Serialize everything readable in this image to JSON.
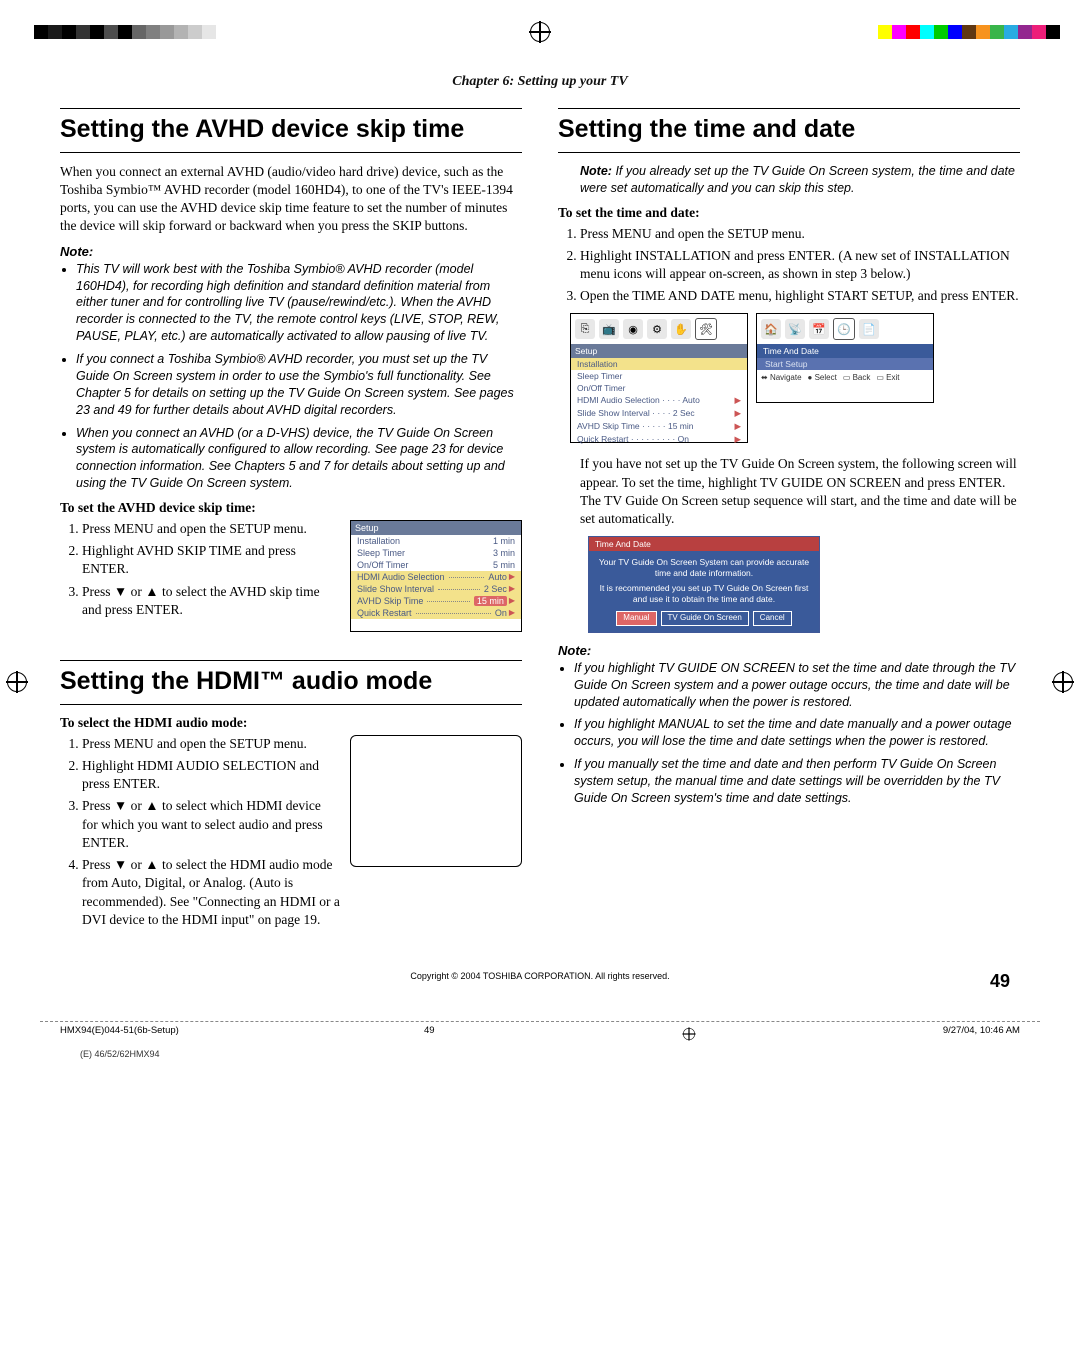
{
  "chapter": "Chapter 6: Setting up your TV",
  "left": {
    "h1": "Setting the AVHD device skip time",
    "intro": "When you connect an external AVHD (audio/video hard drive) device, such as the Toshiba Symbio™ AVHD recorder (model 160HD4), to one of the TV's IEEE-1394 ports, you can use the AVHD device skip time feature to set the number of minutes the device will skip forward or backward when you press the SKIP buttons.",
    "note_head": "Note:",
    "notes": [
      "This TV will work best with the Toshiba Symbio® AVHD recorder (model 160HD4), for recording high definition and standard definition material from either tuner and for controlling live TV (pause/rewind/etc.). When the AVHD recorder is connected to the TV, the remote control keys (LIVE, STOP, REW, PAUSE, PLAY, etc.) are automatically activated to allow pausing of live TV.",
      "If you connect a Toshiba Symbio® AVHD recorder, you must set up the TV Guide On Screen system in order to use the Symbio's full functionality. See Chapter 5 for details on setting up the TV Guide On Screen system. See pages 23 and 49 for further details about AVHD digital recorders.",
      "When you connect an AVHD (or a D-VHS) device, the TV Guide On Screen system is automatically configured to allow recording. See page 23 for device connection information. See Chapters 5 and 7 for details about setting up and using the TV Guide On Screen system."
    ],
    "sub": "To set the AVHD device skip time:",
    "steps": [
      "Press MENU and open the SETUP menu.",
      "Highlight AVHD SKIP TIME and press ENTER.",
      "Press ▼ or ▲ to select the AVHD skip time and press ENTER."
    ],
    "fig1": {
      "title": "Setup",
      "rows": [
        {
          "l": "Installation",
          "v": "1 min"
        },
        {
          "l": "Sleep Timer",
          "v": "3 min"
        },
        {
          "l": "On/Off Timer",
          "v": "5 min"
        },
        {
          "l": "HDMI Audio Selection",
          "d": true,
          "v": "Auto"
        },
        {
          "l": "Slide Show Interval",
          "d": true,
          "v": "2 Sec"
        },
        {
          "l": "AVHD Skip Time",
          "d": true,
          "v": "15 min",
          "sel": true
        },
        {
          "l": "Quick Restart",
          "d": true,
          "v": "On"
        }
      ]
    },
    "h2": "Setting the HDMI™ audio mode",
    "sub2": "To select the HDMI audio mode:",
    "steps2": [
      "Press MENU and open the SETUP menu.",
      "Highlight HDMI AUDIO SELECTION and press ENTER.",
      "Press ▼ or ▲ to select which HDMI device for which you want to select audio and press ENTER.",
      "Press ▼ or ▲ to select the HDMI audio mode from Auto, Digital, or Analog.  (Auto is recommended).   See \"Connecting an HDMI or a DVI device to the HDMI input\" on page 19."
    ]
  },
  "right": {
    "h1": "Setting the time and date",
    "note1_head": "Note:",
    "note1": "If you already set up the TV Guide On Screen system, the time and date were set automatically and you can skip this step.",
    "sub": "To set the time and date:",
    "steps": [
      "Press MENU and open the SETUP menu.",
      "Highlight INSTALLATION and press ENTER. (A new set of INSTALLATION menu icons will appear on-screen, as shown in step 3 below.)",
      "Open the TIME AND DATE menu, highlight START SETUP, and press ENTER."
    ],
    "figA": {
      "title": "Setup",
      "rows": [
        "Installation",
        "Sleep Timer",
        "On/Off Timer",
        "HDMI Audio Selection · · · · Auto",
        "Slide Show Interval · · · · 2 Sec",
        "AVHD Skip Time · · · · · 15 min",
        "Quick Restart · · · · · · · · · On"
      ]
    },
    "figB": {
      "title": "Time And Date",
      "item": "Start Setup",
      "nav": [
        "Navigate",
        "Select",
        "Back",
        "Exit"
      ]
    },
    "mid": "If you have not set up the TV Guide On Screen system, the following screen will appear. To set the time, highlight TV GUIDE ON SCREEN and press ENTER. The TV Guide On Screen setup sequence will start, and the time and date will be set automatically.",
    "figC": {
      "title": "Time And Date",
      "line1": "Your TV Guide On Screen System can provide accurate time and date information.",
      "line2": "It is recommended you set up TV Guide On Screen first and use it to obtain the time and date.",
      "btns": [
        "Manual",
        "TV Guide On Screen",
        "Cancel"
      ]
    },
    "note2_head": "Note:",
    "notes2": [
      "If you highlight TV GUIDE ON SCREEN to set the time and date through the TV Guide On Screen system and a power outage occurs, the time and date will be updated automatically when the power is restored.",
      "If you highlight MANUAL to set the time and date manually and a power outage occurs, you will lose the time and date settings when the power is restored.",
      "If you manually set the time and date and then perform TV Guide On Screen system setup, the manual time and date settings will be overridden by the TV Guide On Screen system's time and date settings."
    ]
  },
  "copyright": "Copyright © 2004 TOSHIBA CORPORATION. All rights reserved.",
  "pagenum": "49",
  "footer": {
    "file": "HMX94(E)044-51(6b-Setup)",
    "page": "49",
    "ts": "9/27/04, 10:46 AM"
  },
  "trim": "(E) 46/52/62HMX94"
}
